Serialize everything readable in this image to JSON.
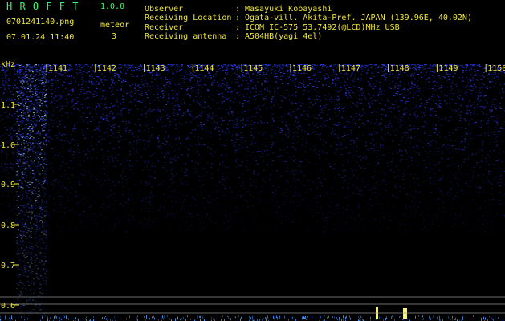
{
  "header": {
    "app_title": "H R O F F T",
    "version": "1.0.0",
    "filename": "0701241140.png",
    "datetime": "07.01.24 11:40",
    "meteor_label": "meteor",
    "meteor_count": "3",
    "fields": [
      {
        "label": "Observer",
        "sep": ":",
        "value": "Masayuki Kobayashi"
      },
      {
        "label": "Receiving Location",
        "sep": ":",
        "value": "Ogata-vill. Akita-Pref. JAPAN (139.96E, 40.02N)"
      },
      {
        "label": "Receiver",
        "sep": ":",
        "value": "ICOM IC-575 53.7492(@LCD)MHz USB"
      },
      {
        "label": "Receiving antenna",
        "sep": ":",
        "value": "A504HB(yagi 4el)"
      }
    ]
  },
  "spectrogram": {
    "y_unit": "kHz",
    "y_ticks": [
      "1.1",
      "1.0",
      "0.9",
      "0.8",
      "0.7",
      "0.6"
    ],
    "y_range": [
      0.57,
      1.13
    ],
    "x_ticks": [
      "1141",
      "1142",
      "1143",
      "1144",
      "1145",
      "1146",
      "1147",
      "1148",
      "1149",
      "1150"
    ],
    "x_range_minutes": [
      1140,
      1150
    ],
    "colors": {
      "background": "#000000",
      "noise": "#2a3cff",
      "signal": "#9ad8ff",
      "echo": "#f5f08a",
      "grid": "#9a9a9a",
      "label": "#f0e63a"
    }
  }
}
